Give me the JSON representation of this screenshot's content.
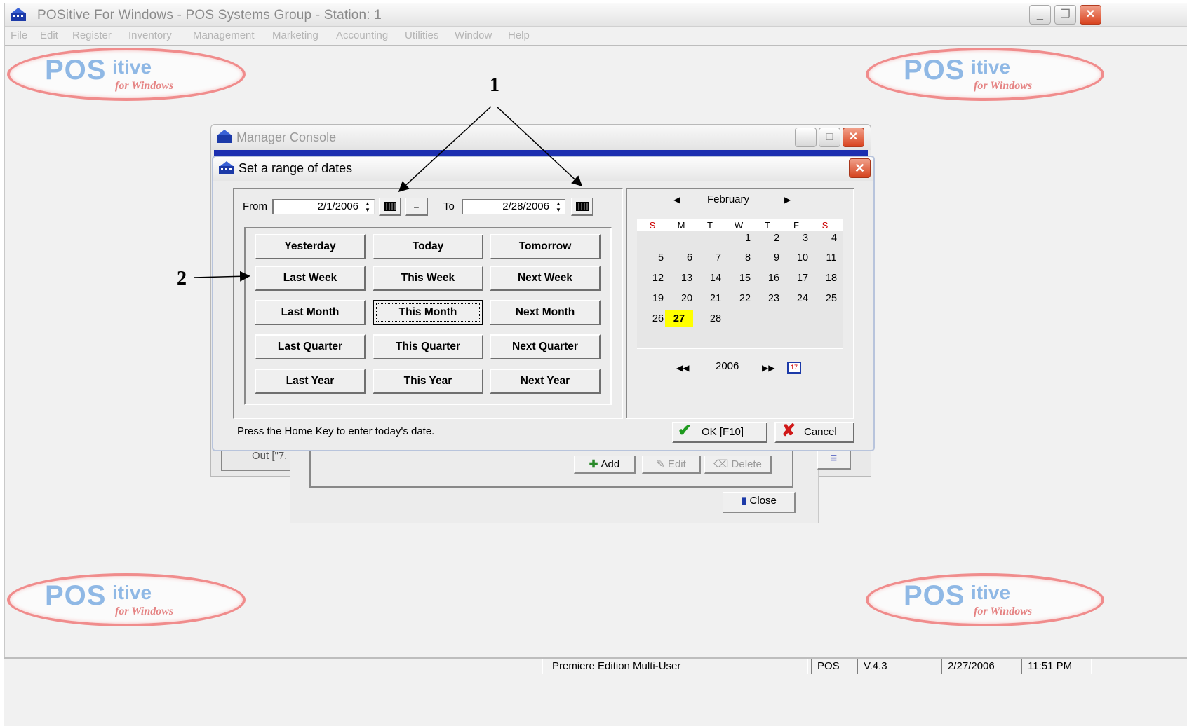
{
  "app": {
    "title": "POSitive For Windows - POS Systems Group - Station: 1",
    "menu": [
      "File",
      "Edit",
      "Register",
      "Inventory",
      "Management",
      "Marketing",
      "Accounting",
      "Utilities",
      "Window",
      "Help"
    ]
  },
  "logo": {
    "pos": "POS",
    "itive": "itive",
    "sub": "for Windows"
  },
  "manager_console": {
    "title": "Manager Console",
    "out_label": "Out [\"7.",
    "add_label": "Add",
    "edit_label": "Edit",
    "delete_label": "Delete",
    "close_label": "Close"
  },
  "dialog": {
    "title": "Set a range of dates",
    "from_label": "From",
    "from_value": "2/1/2006",
    "equals_label": "=",
    "to_label": "To",
    "to_value": "2/28/2006",
    "quick_buttons": [
      [
        "Yesterday",
        "Today",
        "Tomorrow"
      ],
      [
        "Last Week",
        "This Week",
        "Next Week"
      ],
      [
        "Last Month",
        "This Month",
        "Next Month"
      ],
      [
        "Last Quarter",
        "This Quarter",
        "Next Quarter"
      ],
      [
        "Last Year",
        "This Year",
        "Next Year"
      ]
    ],
    "focused_button": "This Month",
    "hint": "Press the Home Key to enter today's date.",
    "ok_label": "OK [F10]",
    "cancel_label": "Cancel"
  },
  "calendar": {
    "month": "February",
    "year": "2006",
    "dow": [
      "S",
      "M",
      "T",
      "W",
      "T",
      "F",
      "S"
    ],
    "weeks": [
      [
        "",
        "",
        "",
        "1",
        "2",
        "3",
        "4"
      ],
      [
        "5",
        "6",
        "7",
        "8",
        "9",
        "10",
        "11"
      ],
      [
        "12",
        "13",
        "14",
        "15",
        "16",
        "17",
        "18"
      ],
      [
        "19",
        "20",
        "21",
        "22",
        "23",
        "24",
        "25"
      ],
      [
        "26",
        "27",
        "28",
        "",
        "",
        "",
        ""
      ]
    ],
    "selected_day": "27",
    "weekend_color": "#cc0000",
    "selected_color": "#ffff00"
  },
  "statusbar": {
    "edition": "Premiere Edition Multi-User",
    "mode": "POS",
    "version": "V.4.3",
    "date": "2/27/2006",
    "time": "11:51 PM"
  },
  "annotations": {
    "one": "1",
    "two": "2"
  }
}
